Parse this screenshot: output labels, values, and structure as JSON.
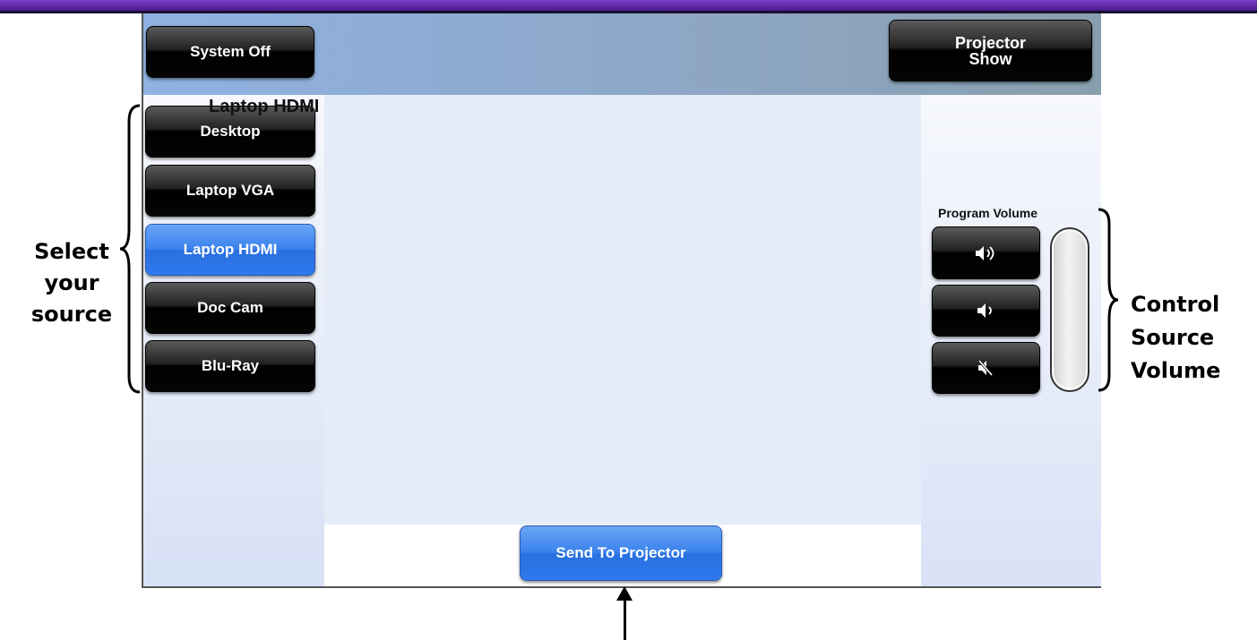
{
  "header": {
    "system_off": "System Off",
    "projector_show_line1": "Projector",
    "projector_show_line2": "Show"
  },
  "sources": [
    {
      "label": "Desktop",
      "active": false
    },
    {
      "label": "Laptop VGA",
      "active": false
    },
    {
      "label": "Laptop HDMI",
      "active": true
    },
    {
      "label": "Doc Cam",
      "active": false
    },
    {
      "label": "Blu-Ray",
      "active": false
    }
  ],
  "main": {
    "selected_source": "Laptop HDMI",
    "send_button": "Send To Projector"
  },
  "volume": {
    "label": "Program Volume",
    "icons": [
      "volume-up-icon",
      "volume-down-icon",
      "mute-icon"
    ]
  },
  "annotations": {
    "left_line1": "Select",
    "left_line2": "your",
    "left_line3": "source",
    "right_line1": "Control",
    "right_line2": "Source",
    "right_line3": "Volume"
  },
  "colors": {
    "accent_active": "#3a82ec",
    "top_bar": "#6a2fb5"
  }
}
